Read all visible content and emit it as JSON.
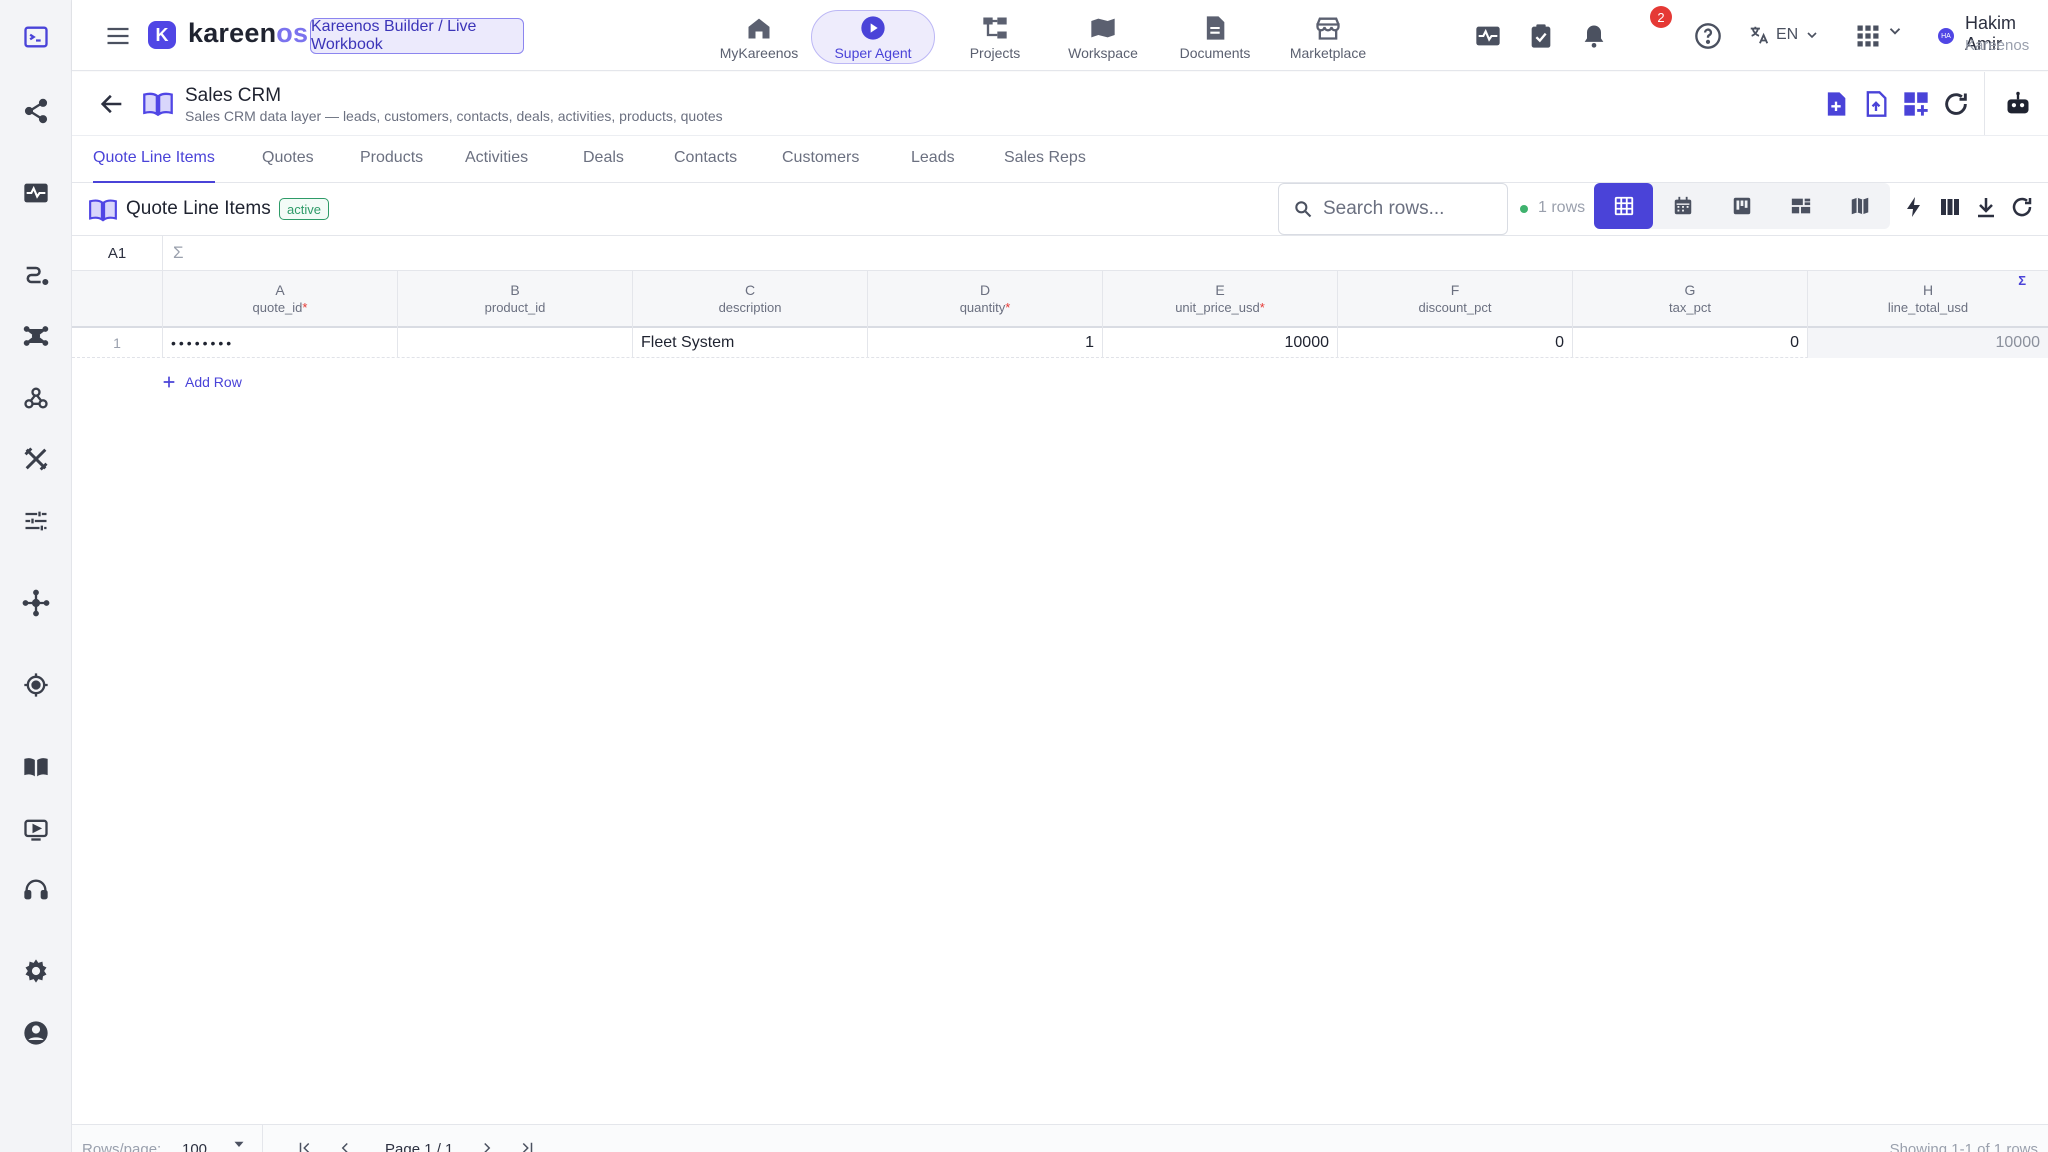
{
  "app": {
    "logo_letter": "K",
    "logo_name": "kareen",
    "logo_suffix": "os",
    "breadcrumb": "Kareenos Builder / Live Workbook"
  },
  "nav": [
    {
      "label": "MyKareenos",
      "icon": "home-icon"
    },
    {
      "label": "Super Agent",
      "icon": "play-circle-icon",
      "active": true
    },
    {
      "label": "Projects",
      "icon": "hierarchy-icon"
    },
    {
      "label": "Workspace",
      "icon": "map-book-icon"
    },
    {
      "label": "Documents",
      "icon": "document-icon"
    },
    {
      "label": "Marketplace",
      "icon": "store-icon"
    }
  ],
  "header": {
    "notifications_count": "2",
    "language": "EN",
    "user_name": "Hakim Amir",
    "user_org": "Kareenos",
    "avatar_initials": "HA"
  },
  "page": {
    "title": "Sales CRM",
    "subtitle": "Sales CRM data layer — leads, customers, contacts, deals, activities, products, quotes"
  },
  "tabs": [
    "Quote Line Items",
    "Quotes",
    "Products",
    "Activities",
    "Deals",
    "Contacts",
    "Customers",
    "Leads",
    "Sales Reps"
  ],
  "active_tab": "Quote Line Items",
  "table": {
    "title": "Quote Line Items",
    "status": "active",
    "search_placeholder": "Search rows...",
    "row_count": "1 rows",
    "cell_ref": "A1",
    "formula_symbol": "Σ",
    "columns": [
      {
        "letter": "A",
        "name": "quote_id",
        "required": "*"
      },
      {
        "letter": "B",
        "name": "product_id",
        "required": ""
      },
      {
        "letter": "C",
        "name": "description",
        "required": ""
      },
      {
        "letter": "D",
        "name": "quantity",
        "required": "*"
      },
      {
        "letter": "E",
        "name": "unit_price_usd",
        "required": "*"
      },
      {
        "letter": "F",
        "name": "discount_pct",
        "required": ""
      },
      {
        "letter": "G",
        "name": "tax_pct",
        "required": ""
      },
      {
        "letter": "H",
        "name": "line_total_usd",
        "required": "",
        "computed_symbol": "Σ"
      }
    ],
    "rows": [
      {
        "num": "1",
        "cells": [
          "••••••••",
          "",
          "Fleet System",
          "1",
          "10000",
          "0",
          "0",
          "10000"
        ]
      }
    ],
    "add_row_label": "Add Row"
  },
  "footer": {
    "rows_per_page_label": "Rows/page:",
    "rows_per_page_value": "100",
    "page_label": "Page 1 / 1",
    "showing": "Showing 1-1 of 1 rows"
  },
  "colors": {
    "accent": "#4a43d8",
    "brand": "#5046e5",
    "active_status": "#2e9b68",
    "notification": "#e53935"
  }
}
